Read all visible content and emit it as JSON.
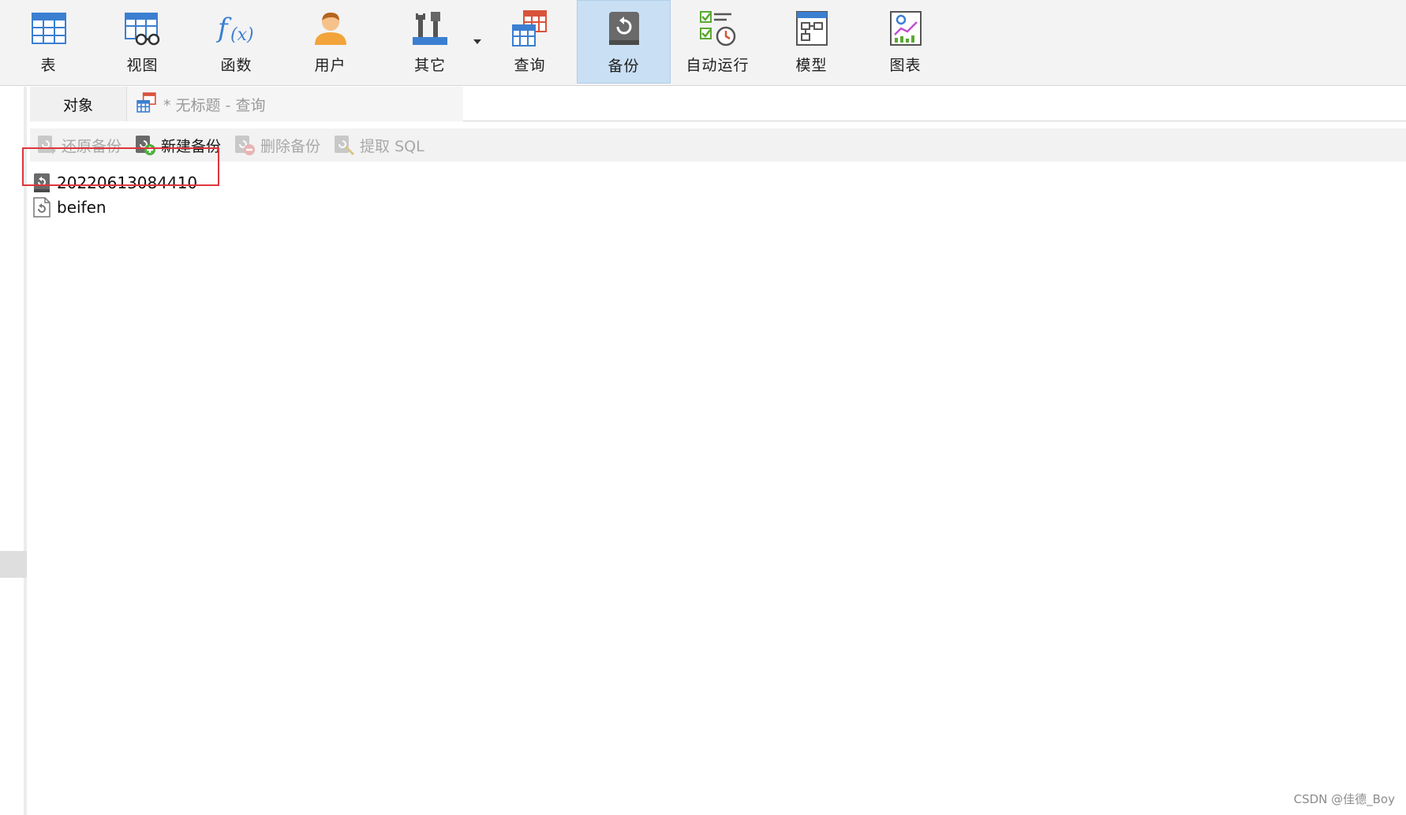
{
  "ribbon": {
    "items": [
      {
        "key": "table",
        "label": "表",
        "icon": "table-icon"
      },
      {
        "key": "view",
        "label": "视图",
        "icon": "view-icon"
      },
      {
        "key": "function",
        "label": "函数",
        "icon": "function-icon"
      },
      {
        "key": "user",
        "label": "用户",
        "icon": "user-icon"
      },
      {
        "key": "other",
        "label": "其它",
        "icon": "tools-icon"
      },
      {
        "key": "query",
        "label": "查询",
        "icon": "query-icon"
      },
      {
        "key": "backup",
        "label": "备份",
        "icon": "backup-icon",
        "active": true
      },
      {
        "key": "automation",
        "label": "自动运行",
        "icon": "automation-icon"
      },
      {
        "key": "model",
        "label": "模型",
        "icon": "model-icon"
      },
      {
        "key": "chart",
        "label": "图表",
        "icon": "chart-icon"
      }
    ]
  },
  "tabs": {
    "objects": "对象",
    "query": "* 无标题 - 查询"
  },
  "toolbar": {
    "restore": "还原备份",
    "new": "新建备份",
    "delete": "删除备份",
    "extract": "提取 SQL"
  },
  "list": {
    "items": [
      "20220613084410",
      "beifen"
    ]
  },
  "watermark": "CSDN @佳德_Boy",
  "colors": {
    "accent_active": "#c9dff3",
    "highlight": "#e0353c",
    "icon_blue": "#3b7fd1"
  }
}
